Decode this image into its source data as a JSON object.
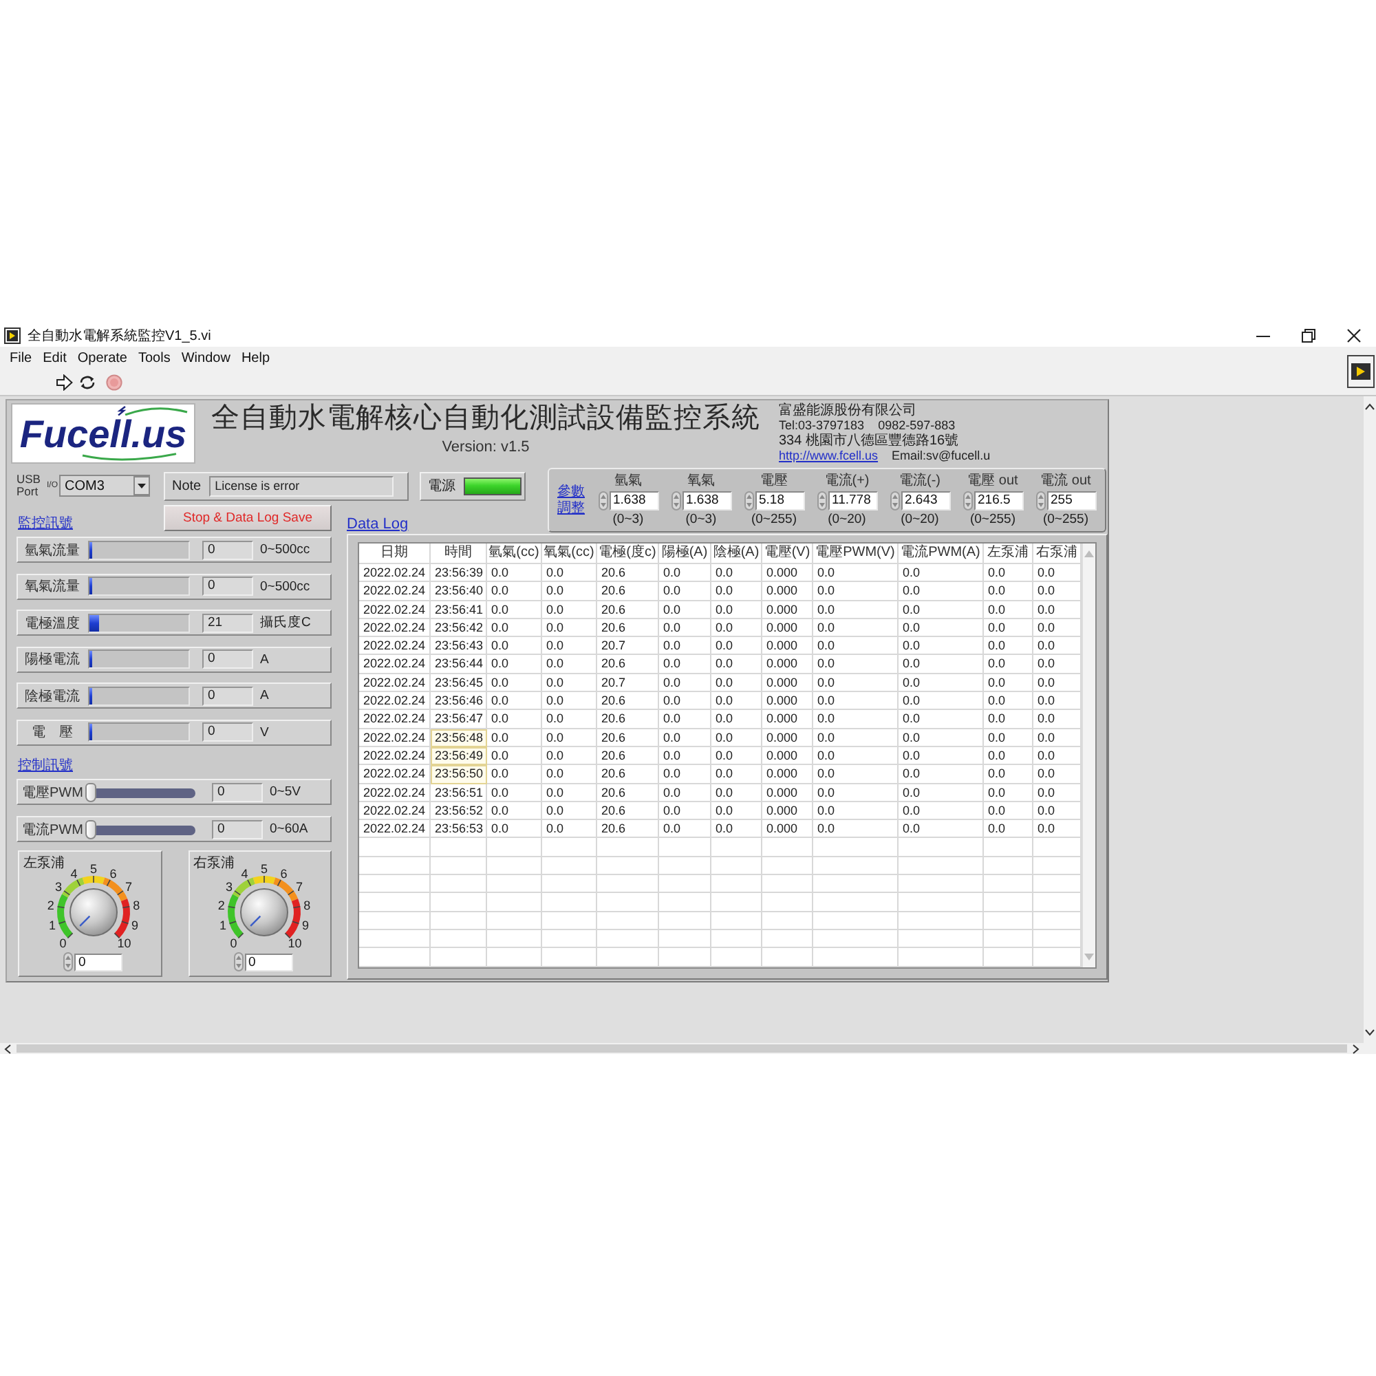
{
  "window": {
    "title": "全自動水電解系統監控V1_5.vi"
  },
  "menu": [
    "File",
    "Edit",
    "Operate",
    "Tools",
    "Window",
    "Help"
  ],
  "header": {
    "logo": "Fucell.us",
    "title": "全自動水電解核心自動化測試設備監控系統",
    "version": "Version: v1.5",
    "company": {
      "name": "富盛能源股份有限公司",
      "phones": [
        "Tel:03-3797183",
        "0982-597-883"
      ],
      "address": "334 桃園市八德區豐德路16號",
      "website": "http://www.fcell.us",
      "email": "Email:sv@fucell.u"
    }
  },
  "port": {
    "label": "USB Port",
    "io_tag": "I/O",
    "value": "COM3"
  },
  "note": {
    "label": "Note",
    "value": "License is error"
  },
  "power": {
    "label": "電源",
    "on": true
  },
  "stop_button": "Stop & Data Log Save",
  "monitor": {
    "title": "監控訊號",
    "rows": [
      {
        "label": "氫氣流量",
        "level": 0,
        "value": "0",
        "unit": "0~500cc"
      },
      {
        "label": "氧氣流量",
        "level": 0,
        "value": "0",
        "unit": "0~500cc"
      },
      {
        "label": "電極溫度",
        "level": 0.1,
        "value": "21",
        "unit": "攝氏度C"
      },
      {
        "label": "陽極電流",
        "level": 0,
        "value": "0",
        "unit": "A"
      },
      {
        "label": "陰極電流",
        "level": 0,
        "value": "0",
        "unit": "A"
      },
      {
        "label": "電　壓",
        "level": 0,
        "value": "0",
        "unit": "V"
      }
    ]
  },
  "parameters": {
    "title": "參數調整",
    "items": [
      {
        "label": "氫氣",
        "value": "1.638",
        "range": "(0~3)"
      },
      {
        "label": "氧氣",
        "value": "1.638",
        "range": "(0~3)"
      },
      {
        "label": "電壓",
        "value": "5.18",
        "range": "(0~255)"
      },
      {
        "label": "電流(+)",
        "value": "11.778",
        "range": "(0~20)"
      },
      {
        "label": "電流(-)",
        "value": "2.643",
        "range": "(0~20)"
      },
      {
        "label": "電壓 out",
        "value": "216.5",
        "range": "(0~255)"
      },
      {
        "label": "電流 out",
        "value": "255",
        "range": "(0~255)"
      }
    ]
  },
  "control": {
    "title": "控制訊號",
    "sliders": [
      {
        "label": "電壓PWM",
        "level": 0,
        "value": "0",
        "unit": "0~5V"
      },
      {
        "label": "電流PWM",
        "level": 0,
        "value": "0",
        "unit": "0~60A"
      }
    ]
  },
  "pumps": [
    {
      "label": "左泵浦",
      "scale": [
        "0",
        "1",
        "2",
        "3",
        "4",
        "5",
        "6",
        "7",
        "8",
        "9",
        "10"
      ],
      "value": "0"
    },
    {
      "label": "右泵浦",
      "scale": [
        "0",
        "1",
        "2",
        "3",
        "4",
        "5",
        "6",
        "7",
        "8",
        "9",
        "10"
      ],
      "value": "0"
    }
  ],
  "data_log": {
    "title": "Data Log",
    "columns": [
      "日期",
      "時間",
      "氫氣(cc)",
      "氧氣(cc)",
      "電極(度c)",
      "陽極(A)",
      "陰極(A)",
      "電壓(V)",
      "電壓PWM(V)",
      "電流PWM(A)",
      "左泵浦",
      "右泵浦"
    ],
    "rows": [
      {
        "cells": [
          "2022.02.24",
          "23:56:39",
          "0.0",
          "0.0",
          "20.6",
          "0.0",
          "0.0",
          "0.000",
          "0.0",
          "0.0",
          "0.0",
          "0.0"
        ],
        "selected": false
      },
      {
        "cells": [
          "2022.02.24",
          "23:56:40",
          "0.0",
          "0.0",
          "20.6",
          "0.0",
          "0.0",
          "0.000",
          "0.0",
          "0.0",
          "0.0",
          "0.0"
        ],
        "selected": false
      },
      {
        "cells": [
          "2022.02.24",
          "23:56:41",
          "0.0",
          "0.0",
          "20.6",
          "0.0",
          "0.0",
          "0.000",
          "0.0",
          "0.0",
          "0.0",
          "0.0"
        ],
        "selected": false
      },
      {
        "cells": [
          "2022.02.24",
          "23:56:42",
          "0.0",
          "0.0",
          "20.6",
          "0.0",
          "0.0",
          "0.000",
          "0.0",
          "0.0",
          "0.0",
          "0.0"
        ],
        "selected": false
      },
      {
        "cells": [
          "2022.02.24",
          "23:56:43",
          "0.0",
          "0.0",
          "20.7",
          "0.0",
          "0.0",
          "0.000",
          "0.0",
          "0.0",
          "0.0",
          "0.0"
        ],
        "selected": false
      },
      {
        "cells": [
          "2022.02.24",
          "23:56:44",
          "0.0",
          "0.0",
          "20.6",
          "0.0",
          "0.0",
          "0.000",
          "0.0",
          "0.0",
          "0.0",
          "0.0"
        ],
        "selected": false
      },
      {
        "cells": [
          "2022.02.24",
          "23:56:45",
          "0.0",
          "0.0",
          "20.7",
          "0.0",
          "0.0",
          "0.000",
          "0.0",
          "0.0",
          "0.0",
          "0.0"
        ],
        "selected": false
      },
      {
        "cells": [
          "2022.02.24",
          "23:56:46",
          "0.0",
          "0.0",
          "20.6",
          "0.0",
          "0.0",
          "0.000",
          "0.0",
          "0.0",
          "0.0",
          "0.0"
        ],
        "selected": false
      },
      {
        "cells": [
          "2022.02.24",
          "23:56:47",
          "0.0",
          "0.0",
          "20.6",
          "0.0",
          "0.0",
          "0.000",
          "0.0",
          "0.0",
          "0.0",
          "0.0"
        ],
        "selected": false
      },
      {
        "cells": [
          "2022.02.24",
          "23:56:48",
          "0.0",
          "0.0",
          "20.6",
          "0.0",
          "0.0",
          "0.000",
          "0.0",
          "0.0",
          "0.0",
          "0.0"
        ],
        "selected": true
      },
      {
        "cells": [
          "2022.02.24",
          "23:56:49",
          "0.0",
          "0.0",
          "20.6",
          "0.0",
          "0.0",
          "0.000",
          "0.0",
          "0.0",
          "0.0",
          "0.0"
        ],
        "selected": true
      },
      {
        "cells": [
          "2022.02.24",
          "23:56:50",
          "0.0",
          "0.0",
          "20.6",
          "0.0",
          "0.0",
          "0.000",
          "0.0",
          "0.0",
          "0.0",
          "0.0"
        ],
        "selected": true
      },
      {
        "cells": [
          "2022.02.24",
          "23:56:51",
          "0.0",
          "0.0",
          "20.6",
          "0.0",
          "0.0",
          "0.000",
          "0.0",
          "0.0",
          "0.0",
          "0.0"
        ],
        "selected": false
      },
      {
        "cells": [
          "2022.02.24",
          "23:56:52",
          "0.0",
          "0.0",
          "20.6",
          "0.0",
          "0.0",
          "0.000",
          "0.0",
          "0.0",
          "0.0",
          "0.0"
        ],
        "selected": false
      },
      {
        "cells": [
          "2022.02.24",
          "23:56:53",
          "0.0",
          "0.0",
          "20.6",
          "0.0",
          "0.0",
          "0.000",
          "0.0",
          "0.0",
          "0.0",
          "0.0"
        ],
        "selected": false
      }
    ]
  }
}
